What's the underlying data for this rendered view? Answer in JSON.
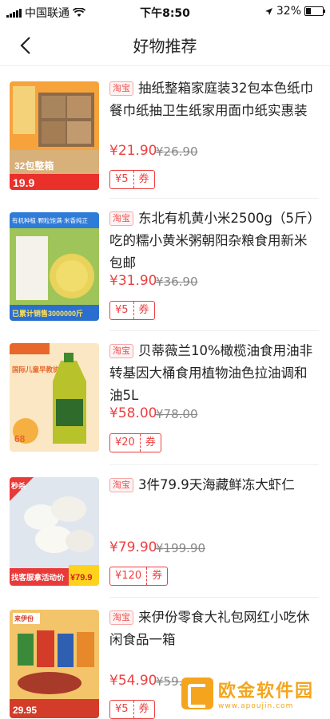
{
  "status": {
    "carrier": "中国联通",
    "time": "下午8:50",
    "battery": "32%",
    "battery_level": 0.32
  },
  "nav": {
    "title": "好物推荐"
  },
  "products": [
    {
      "tag": "淘宝",
      "title": "抽纸整箱家庭装32包本色纸巾餐巾纸抽卫生纸家用面巾纸实惠装",
      "price": "¥21.90",
      "original_price": "¥26.90",
      "coupon_amount": "¥5",
      "coupon_label": "券",
      "thumb": {
        "bg": "#f6a33c",
        "accent": "#f06a1c",
        "lines": [
          "32包整箱",
          "19.9"
        ]
      }
    },
    {
      "tag": "淘宝",
      "title": "东北有机黄小米2500g（5斤）吃的糯小黄米粥朝阳杂粮食用新米包邮",
      "price": "¥31.90",
      "original_price": "¥36.90",
      "coupon_amount": "¥5",
      "coupon_label": "券",
      "thumb": {
        "bg": "#e9d35a",
        "accent": "#2f7bd8",
        "lines": [
          "有机种植·颗粒饱满·米香纯正",
          "已累计销售3000000斤"
        ]
      }
    },
    {
      "tag": "淘宝",
      "title": "贝蒂薇兰10%橄榄油食用油非转基因大桶食用植物油色拉油调和油5L",
      "price": "¥58.00",
      "original_price": "¥78.00",
      "coupon_amount": "¥20",
      "coupon_label": "券",
      "thumb": {
        "bg": "#fbe7c4",
        "accent": "#e7682a",
        "lines": [
          "国际儿童早教协会",
          "68"
        ]
      }
    },
    {
      "tag": "淘宝",
      "title": "3件79.9天海藏鲜冻大虾仁",
      "price": "¥79.90",
      "original_price": "¥199.90",
      "coupon_amount": "¥120",
      "coupon_label": "券",
      "thumb": {
        "bg": "#dfe6ee",
        "accent": "#e93a3a",
        "lines": [
          "秒杀",
          "找客服拿活动价",
          "¥79.9"
        ]
      }
    },
    {
      "tag": "淘宝",
      "title": "来伊份零食大礼包网红小吃休闲食品一箱",
      "price": "¥54.90",
      "original_price": "¥59.90",
      "coupon_amount": "¥5",
      "coupon_label": "券",
      "thumb": {
        "bg": "#f3c46a",
        "accent": "#d43c2a",
        "lines": [
          "来伊份",
          "29.95"
        ]
      }
    }
  ],
  "watermark": {
    "text": "欧金软件园",
    "url": "www.apoujin.com"
  }
}
